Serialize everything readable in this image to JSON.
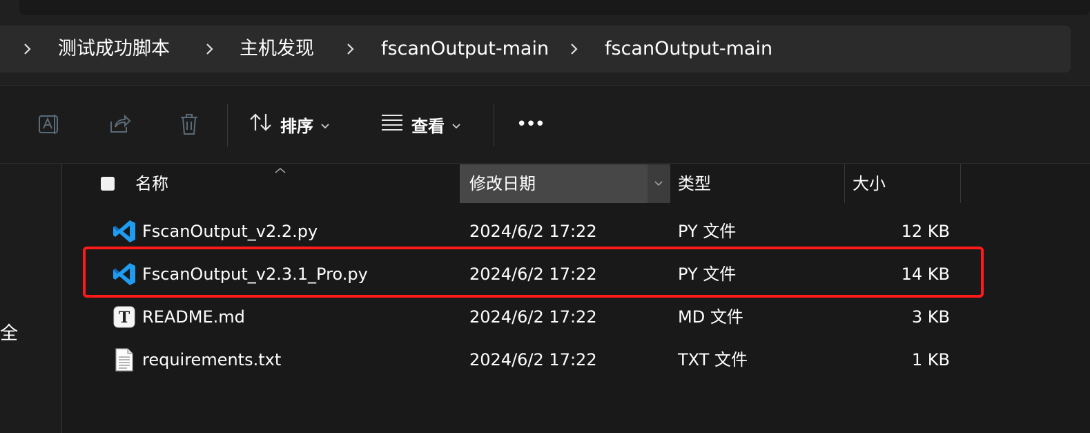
{
  "breadcrumb": [
    "测试成功脚本",
    "主机发现",
    "fscanOutput-main",
    "fscanOutput-main"
  ],
  "toolbar": {
    "sort_label": "排序",
    "view_label": "查看",
    "more_label": "•••"
  },
  "nav_partial_text": "全",
  "columns": {
    "name": "名称",
    "date": "修改日期",
    "type": "类型",
    "size": "大小"
  },
  "files": [
    {
      "name": "FscanOutput_v2.2.py",
      "date": "2024/6/2 17:22",
      "type": "PY 文件",
      "size": "12 KB",
      "icon": "vscode-python-icon"
    },
    {
      "name": "FscanOutput_v2.3.1_Pro.py",
      "date": "2024/6/2 17:22",
      "type": "PY 文件",
      "size": "14 KB",
      "icon": "vscode-python-icon"
    },
    {
      "name": "README.md",
      "date": "2024/6/2 17:22",
      "type": "MD 文件",
      "size": "3 KB",
      "icon": "markdown-file-icon"
    },
    {
      "name": "requirements.txt",
      "date": "2024/6/2 17:22",
      "type": "TXT 文件",
      "size": "1 KB",
      "icon": "text-file-icon"
    }
  ],
  "colors": {
    "highlight": "#ff1a1a",
    "vscode_blue": "#1f9cf0"
  }
}
